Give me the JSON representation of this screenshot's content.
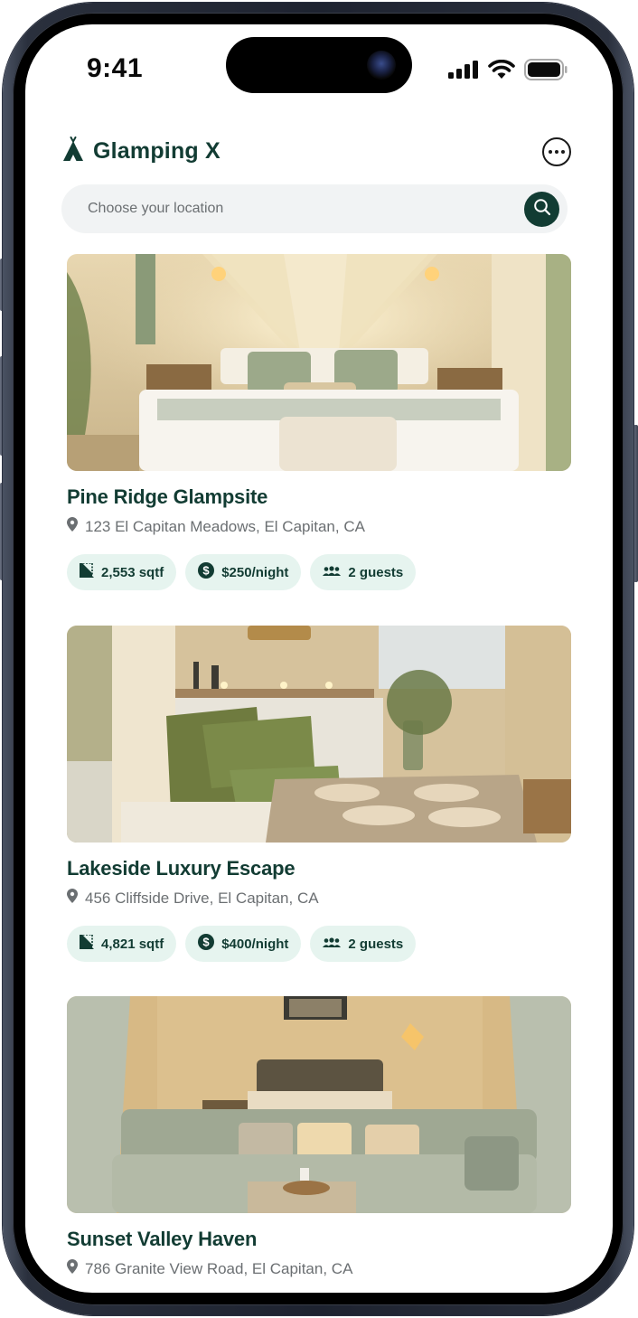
{
  "status_bar": {
    "time": "9:41",
    "icons": [
      "cellular-signal-icon",
      "wifi-icon",
      "battery-icon"
    ]
  },
  "header": {
    "brand_name": "Glamping X",
    "logo_icon": "tent-icon",
    "menu_icon": "more-horizontal-icon"
  },
  "search": {
    "placeholder": "Choose your location",
    "value": "",
    "button_icon": "search-icon"
  },
  "colors": {
    "brand": "#123c33",
    "chip_bg": "#e6f4ef",
    "search_bg": "#f1f3f4",
    "muted_text": "#6b6f72"
  },
  "listings": [
    {
      "title": "Pine Ridge Glampsite",
      "address": "123 El Capitan Meadows, El Capitan, CA",
      "photo": "Tent bedroom with canopy bed, green pillows and wall lamps",
      "chips": [
        {
          "icon": "area-icon",
          "label": "2,553 sqtf"
        },
        {
          "icon": "dollar-icon",
          "label": "$250/night"
        },
        {
          "icon": "guests-icon",
          "label": "2 guests"
        }
      ]
    },
    {
      "title": "Lakeside Luxury Escape",
      "address": "456 Cliffside Drive, El Capitan, CA",
      "photo": "Tent dining nook with olive cushions, candles and set table",
      "chips": [
        {
          "icon": "area-icon",
          "label": "4,821 sqtf"
        },
        {
          "icon": "dollar-icon",
          "label": "$400/night"
        },
        {
          "icon": "guests-icon",
          "label": "2 guests"
        }
      ]
    },
    {
      "title": "Sunset Valley Haven",
      "address": "786 Granite View Road, El Capitan, CA",
      "photo": "Tent lounge with sage sectional sofa, bed and pendant lamp",
      "chips": []
    }
  ]
}
